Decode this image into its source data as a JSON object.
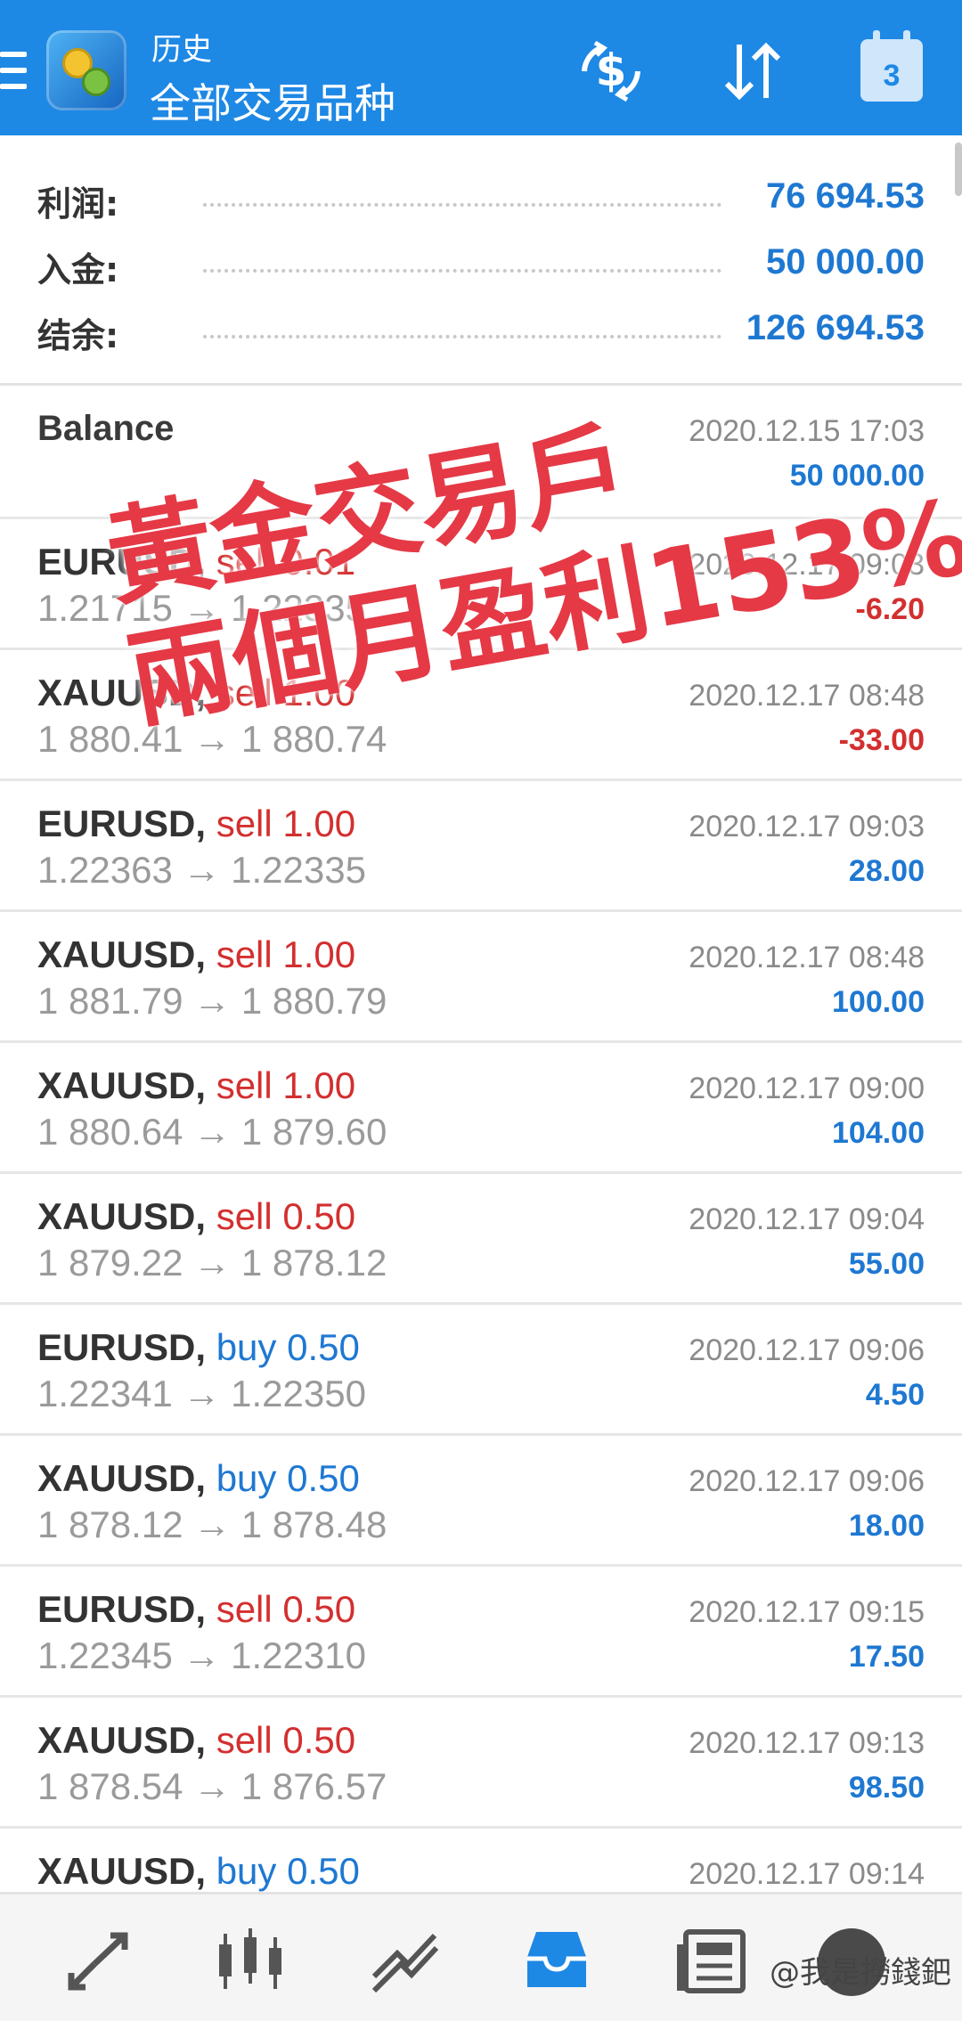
{
  "header": {
    "subtitle": "历史",
    "title": "全部交易品种",
    "calendar_day": "3",
    "bg_color": "#1e88e5"
  },
  "summary": {
    "profit_label": "利润:",
    "profit_value": "76 694.53",
    "deposit_label": "入金:",
    "deposit_value": "50 000.00",
    "balance_label": "结余:",
    "balance_value": "126 694.53"
  },
  "balance_entry": {
    "label": "Balance",
    "datetime": "2020.12.15 17:03",
    "amount": "50 000.00"
  },
  "trades": [
    {
      "symbol": "EURUSD,",
      "side": "sell 0.01",
      "type": "sell",
      "prices": "1.21715 → 1.22335",
      "datetime": "2020.12.17 09:03",
      "profit": "-6.20",
      "neg": true
    },
    {
      "symbol": "XAUUSD,",
      "side": "sell 1.00",
      "type": "sell",
      "prices": "1 880.41 → 1 880.74",
      "datetime": "2020.12.17 08:48",
      "profit": "-33.00",
      "neg": true
    },
    {
      "symbol": "EURUSD,",
      "side": "sell 1.00",
      "type": "sell",
      "prices": "1.22363 → 1.22335",
      "datetime": "2020.12.17 09:03",
      "profit": "28.00",
      "neg": false
    },
    {
      "symbol": "XAUUSD,",
      "side": "sell 1.00",
      "type": "sell",
      "prices": "1 881.79 → 1 880.79",
      "datetime": "2020.12.17 08:48",
      "profit": "100.00",
      "neg": false
    },
    {
      "symbol": "XAUUSD,",
      "side": "sell 1.00",
      "type": "sell",
      "prices": "1 880.64 → 1 879.60",
      "datetime": "2020.12.17 09:00",
      "profit": "104.00",
      "neg": false
    },
    {
      "symbol": "XAUUSD,",
      "side": "sell 0.50",
      "type": "sell",
      "prices": "1 879.22 → 1 878.12",
      "datetime": "2020.12.17 09:04",
      "profit": "55.00",
      "neg": false
    },
    {
      "symbol": "EURUSD,",
      "side": "buy 0.50",
      "type": "buy",
      "prices": "1.22341 → 1.22350",
      "datetime": "2020.12.17 09:06",
      "profit": "4.50",
      "neg": false
    },
    {
      "symbol": "XAUUSD,",
      "side": "buy 0.50",
      "type": "buy",
      "prices": "1 878.12 → 1 878.48",
      "datetime": "2020.12.17 09:06",
      "profit": "18.00",
      "neg": false
    },
    {
      "symbol": "EURUSD,",
      "side": "sell 0.50",
      "type": "sell",
      "prices": "1.22345 → 1.22310",
      "datetime": "2020.12.17 09:15",
      "profit": "17.50",
      "neg": false
    },
    {
      "symbol": "XAUUSD,",
      "side": "sell 0.50",
      "type": "sell",
      "prices": "1 878.54 → 1 876.57",
      "datetime": "2020.12.17 09:13",
      "profit": "98.50",
      "neg": false
    },
    {
      "symbol": "XAUUSD,",
      "side": "buy 0.50",
      "type": "buy",
      "prices": "",
      "datetime": "2020.12.17 09:14",
      "profit": "",
      "neg": false
    }
  ],
  "overlay": {
    "line1": "黃金交易戶",
    "line2": "兩個月盈利153%"
  },
  "bottom_nav": {
    "items": [
      "quotes-icon",
      "chart-icon",
      "trade-icon",
      "history-icon",
      "news-icon",
      "chat-icon"
    ],
    "active": "history-icon"
  },
  "watermark": "@我是撈錢鈀",
  "colors": {
    "profit_positive": "#1e78d2",
    "profit_negative": "#d32f2f",
    "overlay_text": "#e53946"
  }
}
